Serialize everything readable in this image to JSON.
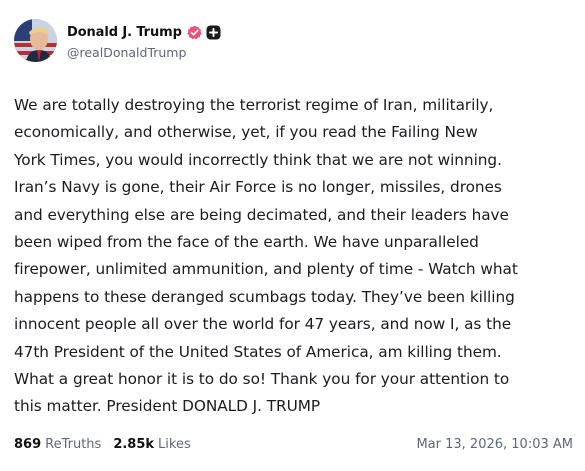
{
  "author": {
    "display_name": "Donald J. Trump",
    "handle": "@realDonaldTrump",
    "verified_icon": "verified-badge-icon",
    "plus_icon": "plus-badge-icon",
    "accent_color": "#e8537a"
  },
  "post": {
    "lines": [
      "We are totally destroying the terrorist regime of Iran, militarily,",
      "economically, and otherwise, yet, if you read the Failing New",
      "York Times, you would incorrectly think that we are not winning.",
      "Iran’s Navy is gone, their Air Force is no longer, missiles, drones",
      "and everything else are being decimated, and their leaders have",
      "been wiped from the face of the earth. We have unparalleled",
      "firepower, unlimited ammunition, and plenty of time - Watch what",
      "happens to these deranged scumbags today. They’ve been killing",
      "innocent people all over the world for 47 years, and now I, as the",
      "47th President of the United States of America, am killing them.",
      "What a great honor it is to do so! Thank you for your attention to",
      "this matter. President DONALD J. TRUMP"
    ]
  },
  "stats": {
    "retruths_count": "869",
    "retruths_label": "ReTruths",
    "likes_count": "2.85k",
    "likes_label": "Likes"
  },
  "timestamp": "Mar 13, 2026, 10:03 AM"
}
